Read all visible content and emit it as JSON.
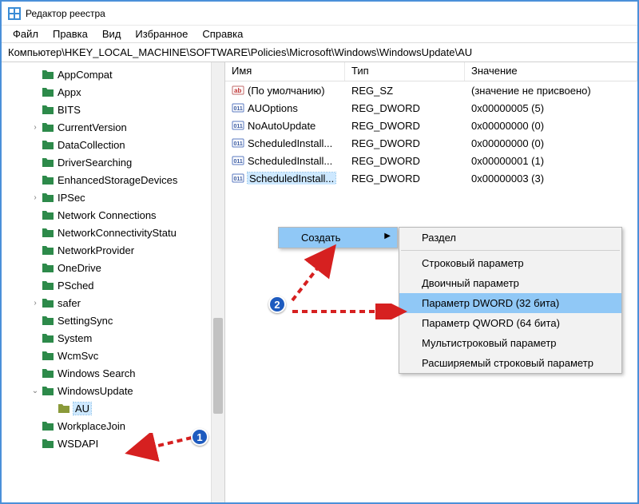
{
  "title": "Редактор реестра",
  "menu": {
    "file": "Файл",
    "edit": "Правка",
    "view": "Вид",
    "favorites": "Избранное",
    "help": "Справка"
  },
  "address": "Компьютер\\HKEY_LOCAL_MACHINE\\SOFTWARE\\Policies\\Microsoft\\Windows\\WindowsUpdate\\AU",
  "columns": {
    "name": "Имя",
    "type": "Тип",
    "value": "Значение"
  },
  "tree": [
    {
      "label": "AppCompat",
      "expandable": false
    },
    {
      "label": "Appx",
      "expandable": false
    },
    {
      "label": "BITS",
      "expandable": false
    },
    {
      "label": "CurrentVersion",
      "expandable": true
    },
    {
      "label": "DataCollection",
      "expandable": false
    },
    {
      "label": "DriverSearching",
      "expandable": false
    },
    {
      "label": "EnhancedStorageDevices",
      "expandable": false
    },
    {
      "label": "IPSec",
      "expandable": true
    },
    {
      "label": "Network Connections",
      "expandable": false
    },
    {
      "label": "NetworkConnectivityStatu",
      "expandable": false
    },
    {
      "label": "NetworkProvider",
      "expandable": false
    },
    {
      "label": "OneDrive",
      "expandable": false
    },
    {
      "label": "PSched",
      "expandable": false
    },
    {
      "label": "safer",
      "expandable": true
    },
    {
      "label": "SettingSync",
      "expandable": false
    },
    {
      "label": "System",
      "expandable": false
    },
    {
      "label": "WcmSvc",
      "expandable": false
    },
    {
      "label": "Windows Search",
      "expandable": false
    },
    {
      "label": "WindowsUpdate",
      "expandable": true,
      "expanded": true,
      "children": [
        {
          "label": "AU",
          "selected": true
        }
      ]
    },
    {
      "label": "WorkplaceJoin",
      "expandable": false
    },
    {
      "label": "WSDAPI",
      "expandable": false
    }
  ],
  "values": [
    {
      "icon": "sz",
      "name": "(По умолчанию)",
      "type": "REG_SZ",
      "value": "(значение не присвоено)",
      "selected": false
    },
    {
      "icon": "dw",
      "name": "AUOptions",
      "type": "REG_DWORD",
      "value": "0x00000005 (5)",
      "selected": false
    },
    {
      "icon": "dw",
      "name": "NoAutoUpdate",
      "type": "REG_DWORD",
      "value": "0x00000000 (0)",
      "selected": false
    },
    {
      "icon": "dw",
      "name": "ScheduledInstall...",
      "type": "REG_DWORD",
      "value": "0x00000000 (0)",
      "selected": false
    },
    {
      "icon": "dw",
      "name": "ScheduledInstall...",
      "type": "REG_DWORD",
      "value": "0x00000001 (1)",
      "selected": false
    },
    {
      "icon": "dw",
      "name": "ScheduledInstall...",
      "type": "REG_DWORD",
      "value": "0x00000003 (3)",
      "selected": true
    }
  ],
  "context1": {
    "new": "Создать"
  },
  "context2": {
    "key": "Раздел",
    "string": "Строковый параметр",
    "binary": "Двоичный параметр",
    "dword": "Параметр DWORD (32 бита)",
    "qword": "Параметр QWORD (64 бита)",
    "multi": "Мультистроковый параметр",
    "expand": "Расширяемый строковый параметр"
  },
  "badges": {
    "b1": "1",
    "b2": "2"
  }
}
